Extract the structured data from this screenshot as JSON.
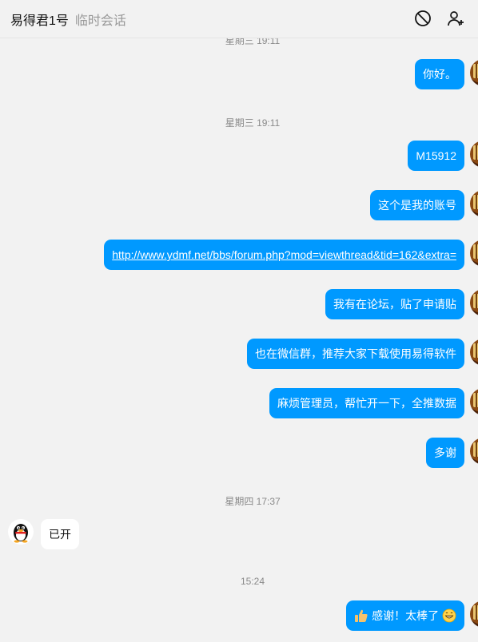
{
  "header": {
    "title": "易得君1号",
    "subtitle": "临时会话"
  },
  "messages": {
    "ts0": "星期三 19:11",
    "m1": "你好。",
    "ts1": "星期三 19:11",
    "m2": "M15912",
    "m3": "这个是我的账号",
    "m4": "http://www.ydmf.net/bbs/forum.php?mod=viewthread&tid=162&extra=",
    "m5": "我有在论坛，贴了申请贴",
    "m6": "也在微信群，推荐大家下载使用易得软件",
    "m7": "麻烦管理员，帮忙开一下，全推数据",
    "m8": "多谢",
    "ts2": "星期四 17:37",
    "r1": "已开",
    "ts3": "15:24",
    "m9": "感谢！太棒了"
  },
  "colors": {
    "outgoing_bubble": "#0099ff",
    "incoming_bubble": "#ffffff",
    "background": "#f2f2f2"
  },
  "icons": [
    "block-icon",
    "add-user-icon",
    "user-avatar",
    "qq-penguin-avatar",
    "thumbs-up-emoji",
    "grin-emoji"
  ]
}
